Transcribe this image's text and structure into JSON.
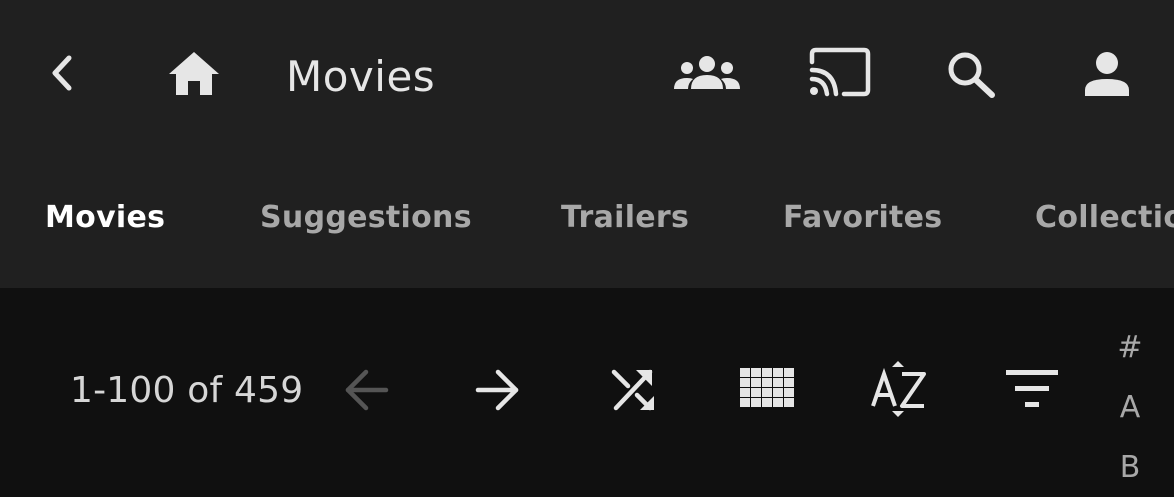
{
  "header": {
    "title": "Movies",
    "icons": {
      "back": "chevron-left-icon",
      "home": "home-icon",
      "sync_play": "group-icon",
      "cast": "cast-icon",
      "search": "search-icon",
      "user": "person-icon"
    }
  },
  "tabs": [
    {
      "label": "Movies",
      "active": true
    },
    {
      "label": "Suggestions",
      "active": false
    },
    {
      "label": "Trailers",
      "active": false
    },
    {
      "label": "Favorites",
      "active": false
    },
    {
      "label": "Collections",
      "active": false
    }
  ],
  "toolbar": {
    "count_text": "1-100 of 459",
    "icons": {
      "previous": "arrow-left-icon",
      "next": "arrow-right-icon",
      "shuffle": "shuffle-icon",
      "view": "grid-icon",
      "sort": "sort-az-icon",
      "filter": "filter-icon"
    }
  },
  "alpha_picker": [
    "#",
    "A",
    "B"
  ],
  "colors": {
    "header_bg": "#202020",
    "content_bg": "#101010",
    "icon": "#e6e6e6",
    "tab_active": "#ffffff",
    "tab_inactive": "#a8a8a8",
    "disabled": "#555555"
  }
}
